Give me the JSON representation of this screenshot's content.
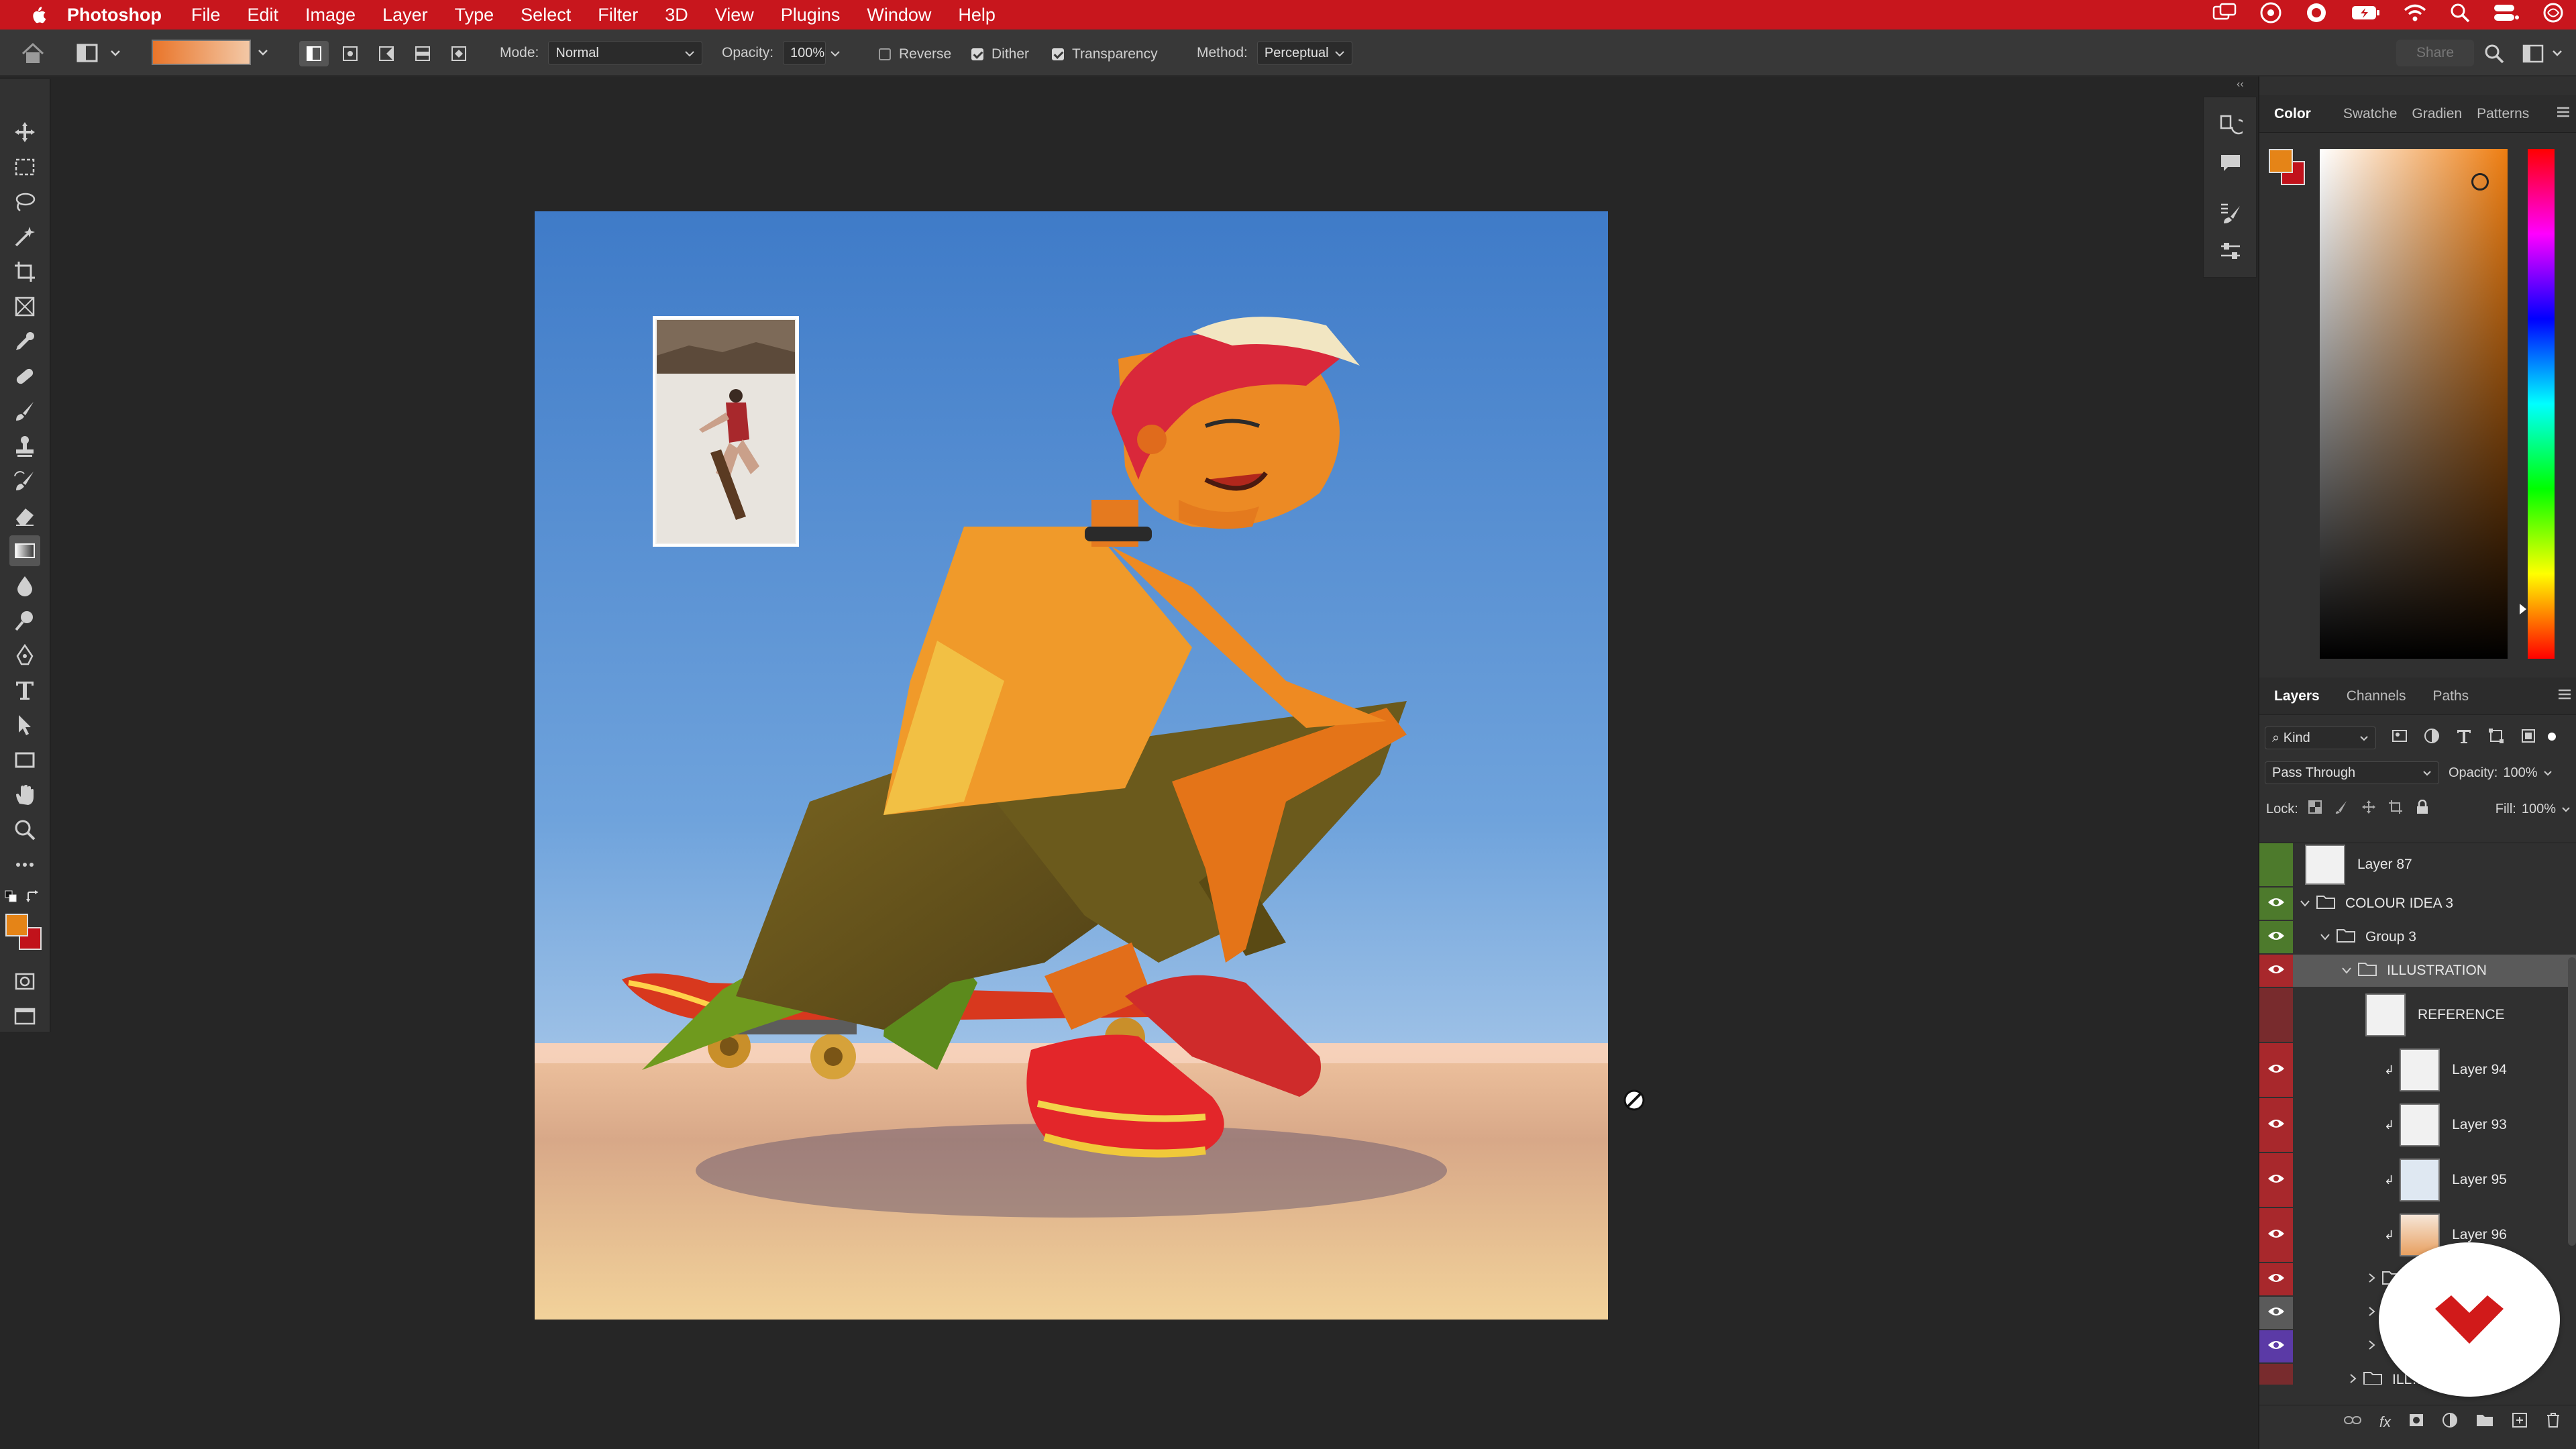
{
  "menubar": {
    "app_name": "Photoshop",
    "items": [
      "File",
      "Edit",
      "Image",
      "Layer",
      "Type",
      "Select",
      "Filter",
      "3D",
      "View",
      "Plugins",
      "Window",
      "Help"
    ],
    "status_icons": [
      "window-switch-icon",
      "creative-cloud-icon",
      "stream-icon",
      "battery-icon",
      "wifi-icon",
      "search-icon",
      "control-center-icon",
      "siri-icon"
    ]
  },
  "options": {
    "mode_label": "Mode:",
    "mode_value": "Normal",
    "opacity_label": "Opacity:",
    "opacity_value": "100%",
    "reverse_label": "Reverse",
    "reverse_checked": false,
    "dither_label": "Dither",
    "dither_checked": true,
    "transparency_label": "Transparency",
    "transparency_checked": true,
    "method_label": "Method:",
    "method_value": "Perceptual",
    "share_label": "Share",
    "gradient_colors": [
      "#e9752a",
      "#f3c8a6"
    ]
  },
  "toolbar": {
    "tools": [
      "move-tool-icon",
      "marquee-tool-icon",
      "lasso-tool-icon",
      "magic-wand-icon",
      "crop-tool-icon",
      "frame-tool-icon",
      "eyedropper-icon",
      "healing-brush-icon",
      "brush-tool-icon",
      "clone-stamp-icon",
      "history-brush-icon",
      "eraser-icon",
      "gradient-tool-icon",
      "blur-tool-icon",
      "dodge-tool-icon",
      "pen-tool-icon",
      "type-tool-icon",
      "path-select-icon",
      "rectangle-tool-icon",
      "hand-tool-icon",
      "zoom-tool-icon",
      "more-tools-icon"
    ],
    "active_tool": "gradient-tool-icon",
    "foreground_color": "#e58417",
    "background_color": "#c1121b"
  },
  "color_panel": {
    "tabs": [
      "Color",
      "Swatche",
      "Gradien",
      "Patterns"
    ],
    "active_tab": "Color",
    "foreground": "#e58417",
    "background": "#c1121b",
    "hue_color": "#ee7d10"
  },
  "layers_panel": {
    "tabs": [
      "Layers",
      "Channels",
      "Paths"
    ],
    "active_tab": "Layers",
    "filter_label": "Kind",
    "blend_mode": "Pass Through",
    "opacity_label": "Opacity:",
    "opacity_value": "100%",
    "lock_label": "Lock:",
    "fill_label": "Fill:",
    "fill_value": "100%",
    "layers": [
      {
        "name": "Layer 87",
        "type": "layer",
        "visible": false,
        "color": "#4d7a2c"
      },
      {
        "name": "COLOUR IDEA 3",
        "type": "group",
        "visible": true,
        "color": "#4d7a2c"
      },
      {
        "name": "Group 3",
        "type": "group",
        "visible": true,
        "color": "#4d7a2c"
      },
      {
        "name": "ILLUSTRATION",
        "type": "group",
        "visible": true,
        "color": "#a8282c",
        "selected": true
      },
      {
        "name": "REFERENCE",
        "type": "layer",
        "visible": false,
        "color": "#a8282c"
      },
      {
        "name": "Layer 94",
        "type": "clipped",
        "visible": true,
        "color": "#a8282c"
      },
      {
        "name": "Layer 93",
        "type": "clipped",
        "visible": true,
        "color": "#a8282c"
      },
      {
        "name": "Layer 95",
        "type": "clipped",
        "visible": true,
        "color": "#a8282c"
      },
      {
        "name": "Layer 96",
        "type": "clipped",
        "visible": true,
        "color": "#a8282c"
      },
      {
        "name": "",
        "type": "group",
        "visible": true,
        "color": "#a8282c"
      },
      {
        "name": "",
        "type": "group",
        "visible": true,
        "color": "#5a5a5a"
      },
      {
        "name": "",
        "type": "group",
        "visible": true,
        "color": "#5b3aa6"
      },
      {
        "name": "ILL…ON copy",
        "type": "group",
        "visible": false,
        "color": "#a8282c"
      }
    ],
    "footer_icons": [
      "link-layers-icon",
      "fx-icon",
      "add-mask-icon",
      "adjustment-layer-icon",
      "new-group-icon",
      "new-layer-icon",
      "delete-layer-icon"
    ]
  }
}
